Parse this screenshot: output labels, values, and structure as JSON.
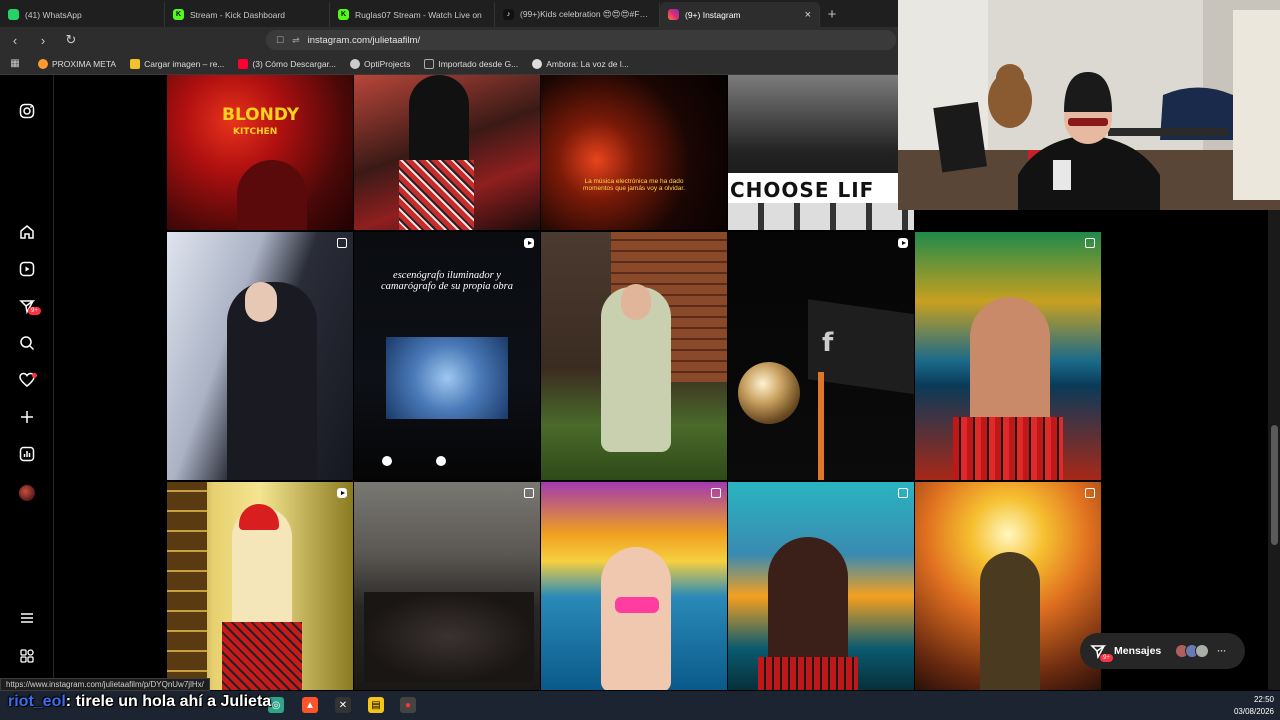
{
  "tabs": [
    {
      "title": "(41) WhatsApp",
      "fav_color": "#25d366",
      "fav_glyph": "●"
    },
    {
      "title": "Stream - Kick Dashboard",
      "fav_color": "#53fc18",
      "fav_glyph": "K"
    },
    {
      "title": "Ruglas07 Stream - Watch Live on",
      "fav_color": "#53fc18",
      "fav_glyph": "K"
    },
    {
      "title": "(99+)Kids celebration 😍😍😍#Foot",
      "fav_color": "#ffffff",
      "fav_glyph": "♪"
    },
    {
      "title": "(9+) Instagram",
      "fav_color": "#e1306c",
      "fav_glyph": "◎",
      "active": true
    }
  ],
  "address": {
    "url": "instagram.com/julietaafilm/"
  },
  "bookmarks": [
    {
      "label": "PROXIMA META",
      "color": "#ff9a2e"
    },
    {
      "label": "Cargar imagen – re...",
      "color": "#f2c12e"
    },
    {
      "label": "(3) Cómo Descargar...",
      "color": "#ff0033"
    },
    {
      "label": "OptiProjects",
      "color": "#cccccc"
    },
    {
      "label": "Importado desde G...",
      "color": "#aaaaaa"
    },
    {
      "label": "Ambora: La voz de l...",
      "color": "#dddddd"
    }
  ],
  "posts": {
    "blondy_sign": "BLONDY",
    "blondy_sub": "KITCHEN",
    "electro_caption": "La música electrónica me ha dado momentos que jamás voy a olvidar.",
    "choose_life": "CHOOSE LIF",
    "escenografo_caption": "escenógrafo iluminador y camarógrafo de su propia obra",
    "fest_sign": "f"
  },
  "messages": {
    "label": "Mensajes",
    "badge": "9+"
  },
  "nav_badge": "9+",
  "status_url": "https://www.instagram.com/julietaafilm/p/DYQnUw7jlHx/",
  "chat": {
    "user": "riot_eol",
    "message": ": tirele un hola ahí a Julieta"
  },
  "clock": {
    "time": "22:50",
    "date": "03/08/2026"
  }
}
